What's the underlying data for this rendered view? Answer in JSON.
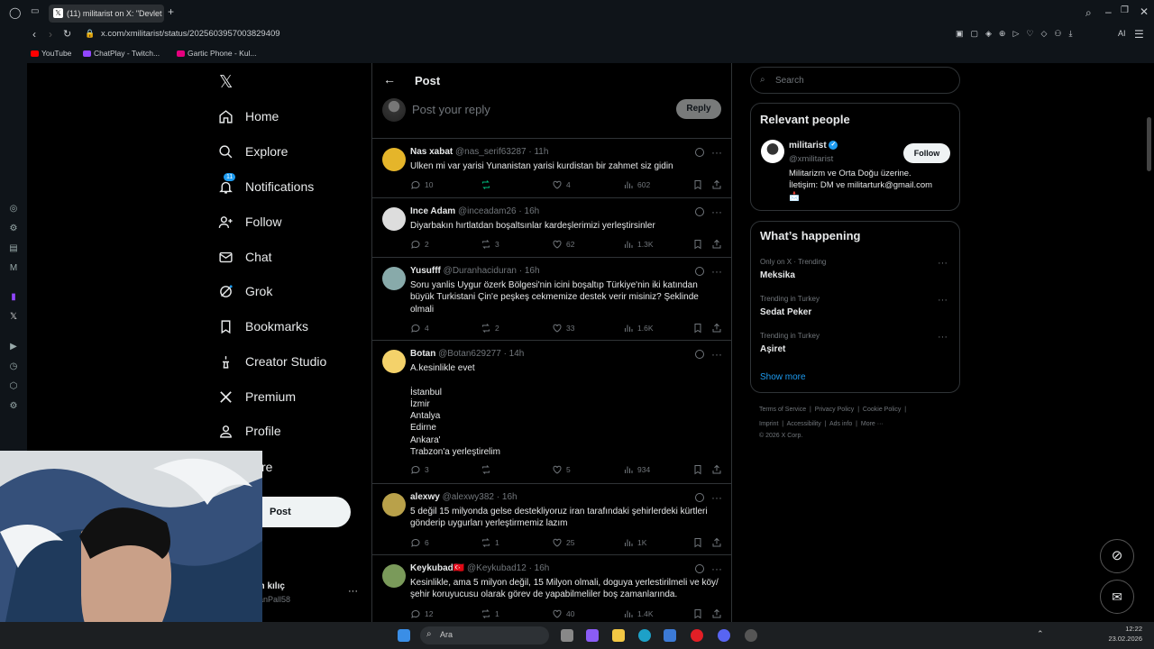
{
  "browser": {
    "tab_title": "(11) militarist on X: \"Devlet",
    "url": "x.com/xmilitarist/status/2025603957003829409",
    "bookmarks": [
      "YouTube",
      "ChatPlay - Twitch...",
      "Gartic Phone - Kul..."
    ],
    "ai_label": "AI"
  },
  "nav": {
    "items": [
      {
        "label": "Home",
        "icon": "home-icon"
      },
      {
        "label": "Explore",
        "icon": "search-icon"
      },
      {
        "label": "Notifications",
        "icon": "bell-icon",
        "badge": "11"
      },
      {
        "label": "Follow",
        "icon": "add-person-icon"
      },
      {
        "label": "Chat",
        "icon": "mail-icon"
      },
      {
        "label": "Grok",
        "icon": "grok-icon"
      },
      {
        "label": "Bookmarks",
        "icon": "bookmark-icon"
      },
      {
        "label": "Creator Studio",
        "icon": "creator-icon"
      },
      {
        "label": "Premium",
        "icon": "x-icon"
      },
      {
        "label": "Profile",
        "icon": "person-icon"
      },
      {
        "label": "re",
        "icon": "more-icon"
      }
    ],
    "post_button": "Post",
    "account_name": "an kılıç",
    "account_handle": "aanPall58"
  },
  "header": {
    "title": "Post"
  },
  "composer": {
    "placeholder": "Post your reply",
    "reply_button": "Reply"
  },
  "posts": [
    {
      "name": "Nas xabat",
      "handle": "@nas_serif63287",
      "time": "· 11h",
      "text": "Ulken mi var yarisi Yunanistan yarisi kurdistan bir zahmet siz gidin",
      "replies": "10",
      "reposts": "",
      "likes": "4",
      "views": "602"
    },
    {
      "name": "Ince Adam",
      "handle": "@inceadam26",
      "time": "· 16h",
      "text": "Diyarbakın hırtlatdan boşaltsınlar kardeşlerimizi yerleştirsinler",
      "replies": "2",
      "reposts": "3",
      "likes": "62",
      "views": "1.3K"
    },
    {
      "name": "Yusufff",
      "handle": "@Duranhaciduran",
      "time": "· 16h",
      "text": "Soru yanlis Uygur özerk Bölgesi'nin icini boşaltıp Türkiye'nin iki katından büyük Turkistani Çin'e peşkeş cekmemize destek verir misiniz? Şeklinde olmali",
      "replies": "4",
      "reposts": "2",
      "likes": "33",
      "views": "1.6K"
    },
    {
      "name": "Botan",
      "handle": "@Botan629277",
      "time": "· 14h",
      "text": "A.kesinlikle evet\n\nİstanbul\nİzmir\nAntalya\nEdirne\nAnkara'\nTrabzon'a yerleştirelim",
      "replies": "3",
      "reposts": "",
      "likes": "5",
      "views": "934"
    },
    {
      "name": "alexwy",
      "handle": "@alexwy382",
      "time": "· 16h",
      "text": "5 değil 15 milyonda gelse destekliyoruz iran tarafındaki şehirlerdeki kürtleri gönderip  uygurları yerleştirmemiz lazım",
      "replies": "6",
      "reposts": "1",
      "likes": "25",
      "views": "1K"
    },
    {
      "name": "Keykubad🇹🇷",
      "handle": "@Keykubad12",
      "time": "· 16h",
      "text": "Kesinlikle, ama 5 milyon değil, 15 Milyon olmali, doguya yerlestirilmeli ve köy/şehir koruyucusu olarak görev de yapabilmeliler boş zamanlarında.",
      "replies": "12",
      "reposts": "1",
      "likes": "40",
      "views": "1.4K"
    }
  ],
  "search": {
    "placeholder": "Search"
  },
  "relevant": {
    "title": "Relevant people",
    "name": "militarist",
    "handle": "@xmilitarist",
    "follow": "Follow",
    "bio": "Militarizm ve Orta Doğu üzerine.\nİletişim: DM ve militarturk@gmail.com\n📩"
  },
  "happening": {
    "title": "What’s happening",
    "trends": [
      {
        "context": "Only on X · Trending",
        "name": "Meksika"
      },
      {
        "context": "Trending in Turkey",
        "name": "Sedat Peker"
      },
      {
        "context": "Trending in Turkey",
        "name": "Aşiret"
      }
    ],
    "show_more": "Show more"
  },
  "footer": {
    "line1": [
      "Terms of Service",
      "Privacy Policy",
      "Cookie Policy"
    ],
    "line2": [
      "Imprint",
      "Accessibility",
      "Ads info",
      "More ···"
    ],
    "copyright": "© 2026 X Corp."
  },
  "taskbar": {
    "search": "Ara",
    "time": "12:22",
    "date": "23.02.2026"
  },
  "colors": {
    "accent": "#1d9bf0",
    "repost_green": "#00ba7c",
    "bg": "#000000",
    "border": "#2f3336",
    "muted": "#71767b"
  }
}
